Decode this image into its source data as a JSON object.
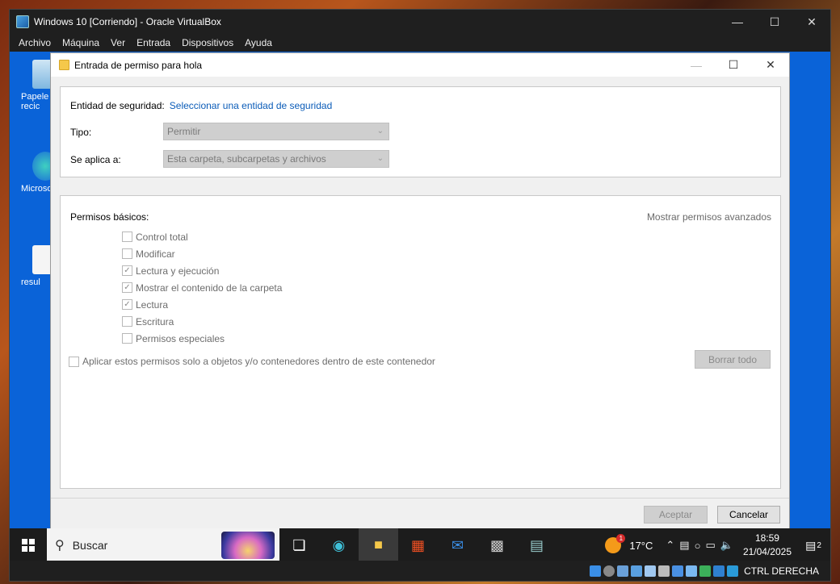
{
  "host": {
    "title": "Windows 10 [Corriendo] - Oracle VirtualBox",
    "menu": [
      "Archivo",
      "Máquina",
      "Ver",
      "Entrada",
      "Dispositivos",
      "Ayuda"
    ],
    "status_text": "CTRL DERECHA"
  },
  "desktop": {
    "icons": [
      "Papele recic",
      "Microso",
      "resul"
    ]
  },
  "dialog": {
    "title": "Entrada de permiso para hola",
    "principal_label": "Entidad de seguridad:",
    "principal_link": "Seleccionar una entidad de seguridad",
    "type_label": "Tipo:",
    "type_value": "Permitir",
    "applies_label": "Se aplica a:",
    "applies_value": "Esta carpeta, subcarpetas y archivos",
    "basic_perms_label": "Permisos básicos:",
    "advanced_link": "Mostrar permisos avanzados",
    "permissions": [
      {
        "label": "Control total",
        "checked": false
      },
      {
        "label": "Modificar",
        "checked": false
      },
      {
        "label": "Lectura y ejecución",
        "checked": true
      },
      {
        "label": "Mostrar el contenido de la carpeta",
        "checked": true
      },
      {
        "label": "Lectura",
        "checked": true
      },
      {
        "label": "Escritura",
        "checked": false
      },
      {
        "label": "Permisos especiales",
        "checked": false
      }
    ],
    "apply_only_label": "Aplicar estos permisos solo a objetos y/o contenedores dentro de este contenedor",
    "clear_all_label": "Borrar todo",
    "ok_label": "Aceptar",
    "cancel_label": "Cancelar"
  },
  "taskbar": {
    "search_placeholder": "Buscar",
    "temperature": "17°C",
    "weather_badge": "1",
    "time": "18:59",
    "date": "21/04/2025",
    "notification_count": "2"
  }
}
